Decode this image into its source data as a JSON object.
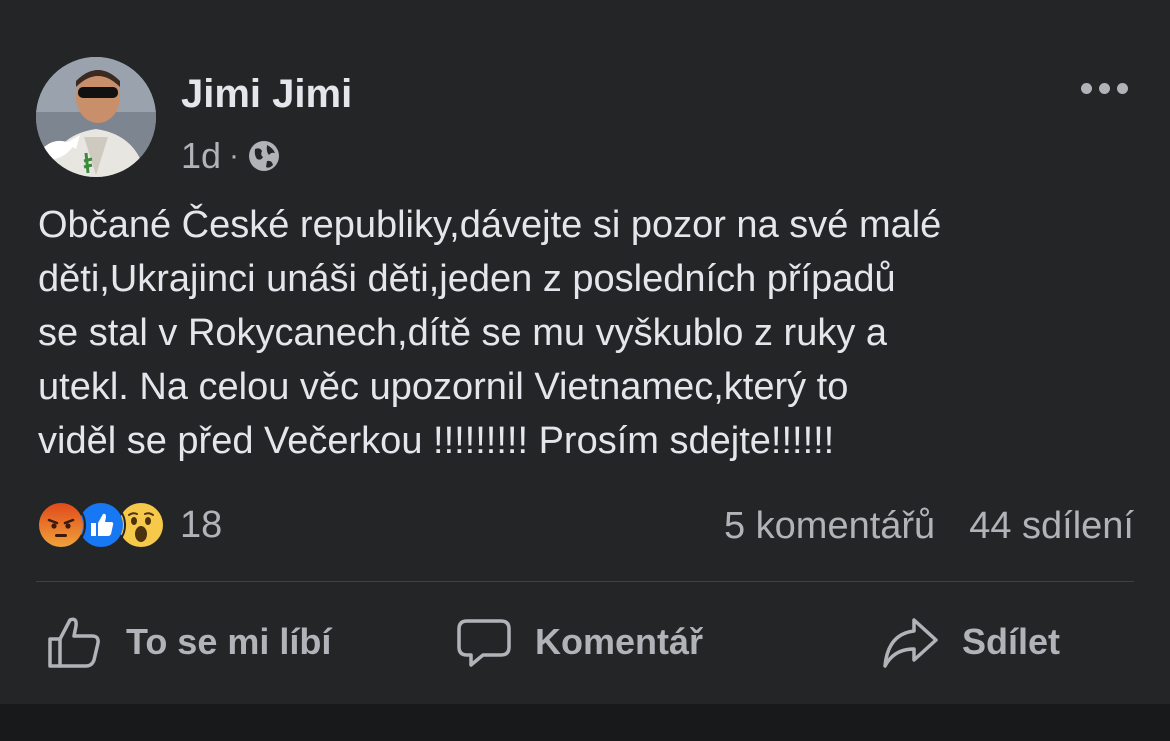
{
  "post": {
    "author": "Jimi Jimi",
    "time": "1d",
    "separator": "·",
    "privacy_icon": "globe-icon",
    "more_icon": "more-horizontal-icon",
    "text": "Občané České republiky,dávejte si pozor na své malé\nděti,Ukrajinci unáši děti,jeden z posledních případů\nse stal v Rokycanech,dítě se mu vyškublo z ruky a\nutekl. Na celou věc upozornil Vietnamec,který to\nviděl se před Večerkou !!!!!!!!! Prosím sdejte!!!!!!"
  },
  "reactions": {
    "icons": [
      "angry-reaction-icon",
      "like-reaction-icon",
      "wow-reaction-icon"
    ],
    "count": "18"
  },
  "stats": {
    "comments": "5 komentářů",
    "shares": "44 sdílení"
  },
  "actions": {
    "like_label": "To se mi líbí",
    "comment_label": "Komentář",
    "share_label": "Sdílet"
  },
  "colors": {
    "background": "#242526",
    "text": "#e4e6eb",
    "secondary_text": "#b0b3b8",
    "like_blue": "#1877f2",
    "angry_orange": "#e9710f",
    "wow_yellow": "#f7c94b"
  }
}
